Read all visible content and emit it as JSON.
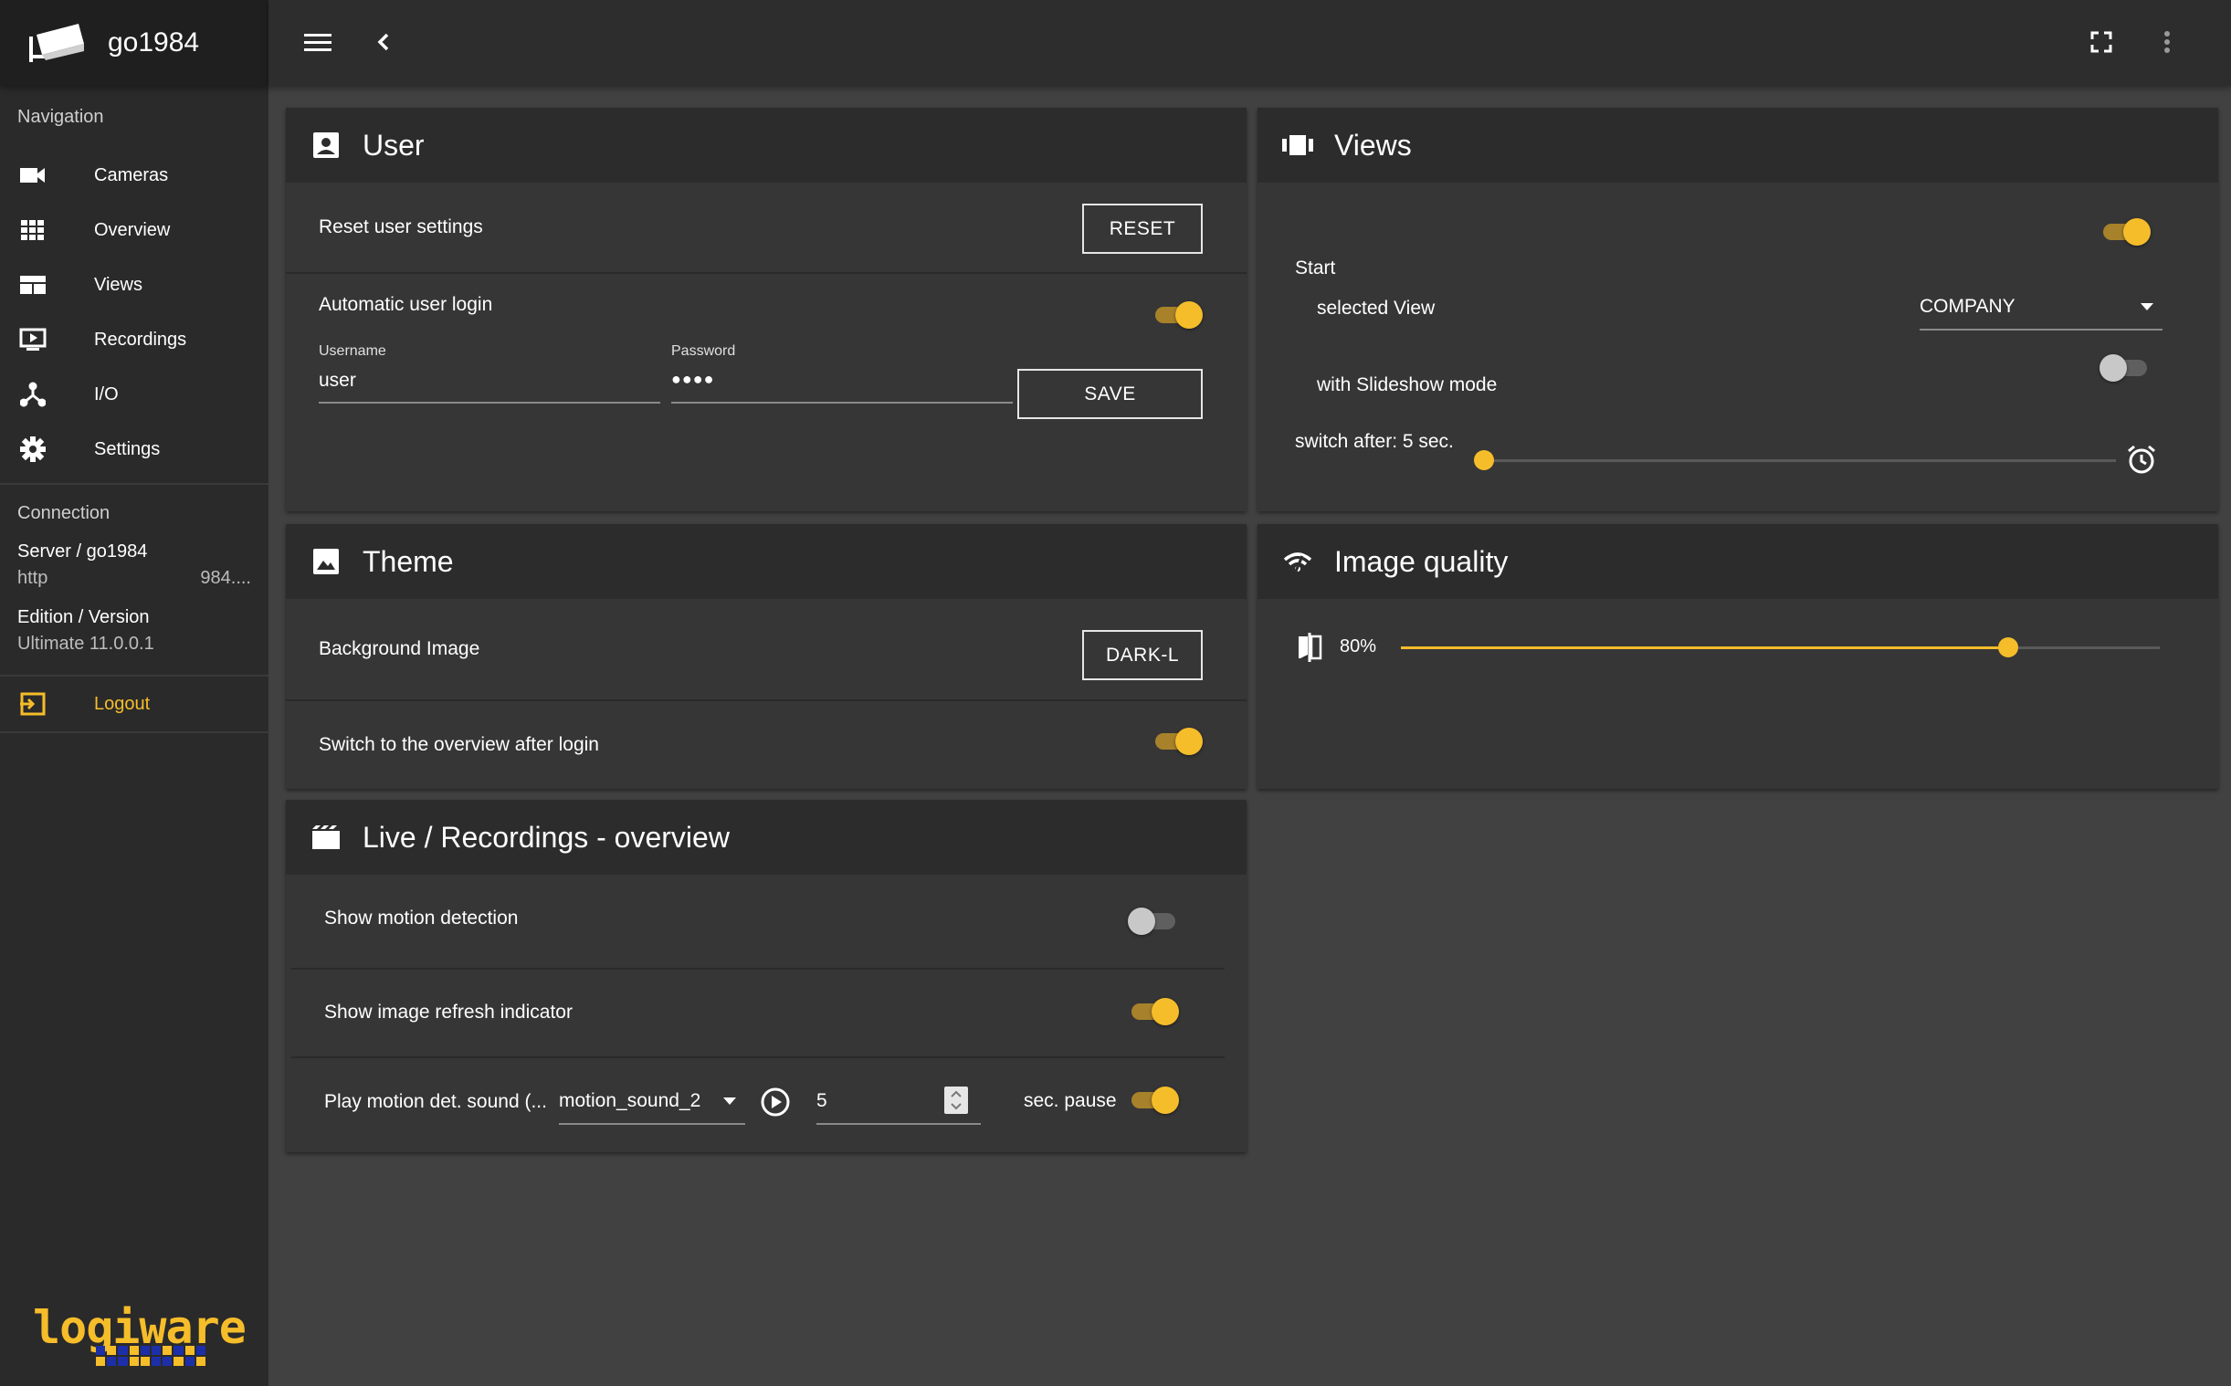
{
  "app": {
    "title": "go1984"
  },
  "sidebar": {
    "navigation_label": "Navigation",
    "items": [
      {
        "label": "Cameras",
        "icon": "camera-icon"
      },
      {
        "label": "Overview",
        "icon": "grid-icon"
      },
      {
        "label": "Views",
        "icon": "views-icon"
      },
      {
        "label": "Recordings",
        "icon": "recordings-icon"
      },
      {
        "label": "I/O",
        "icon": "io-icon"
      },
      {
        "label": "Settings",
        "icon": "gear-icon"
      }
    ],
    "connection_label": "Connection",
    "server_label": "Server / go1984",
    "server_url_prefix": "http",
    "server_url_suffix": "984....",
    "edition_label": "Edition / Version",
    "edition_value": "Ultimate 11.0.0.1",
    "logout_label": "Logout",
    "footer_logo_text_a": "logi",
    "footer_logo_text_b": "ware"
  },
  "user_card": {
    "title": "User",
    "reset_label": "Reset user settings",
    "reset_button": "RESET",
    "auto_login_label": "Automatic user login",
    "auto_login_on": true,
    "username_label": "Username",
    "username_value": "user",
    "password_label": "Password",
    "password_value": "●●●●",
    "save_button": "SAVE"
  },
  "views_card": {
    "title": "Views",
    "start_label": "Start",
    "start_on": true,
    "selected_view_label": "selected View",
    "selected_view_value": "COMPANY",
    "slideshow_label": "with Slideshow mode",
    "slideshow_on": false,
    "switch_after_label": "switch after: 5 sec.",
    "switch_after_fraction": 0.0
  },
  "theme_card": {
    "title": "Theme",
    "background_label": "Background Image",
    "background_button": "DARK-L",
    "switch_overview_label": "Switch to the overview after login",
    "switch_overview_on": true
  },
  "quality_card": {
    "title": "Image quality",
    "value_label": "80%",
    "value_fraction": 0.8
  },
  "live_card": {
    "title": "Live / Recordings - overview",
    "motion_label": "Show motion detection",
    "motion_on": false,
    "refresh_label": "Show image refresh indicator",
    "refresh_on": true,
    "sound_label": "Play motion det. sound (...",
    "sound_value": "motion_sound_2",
    "pause_value": "5",
    "pause_label": "sec. pause",
    "sound_on": true
  },
  "colors": {
    "accent": "#f6bd2a",
    "bg": "#414141",
    "card": "#363636",
    "header": "#2c2c2c",
    "sidebar": "#2a2a2a"
  }
}
